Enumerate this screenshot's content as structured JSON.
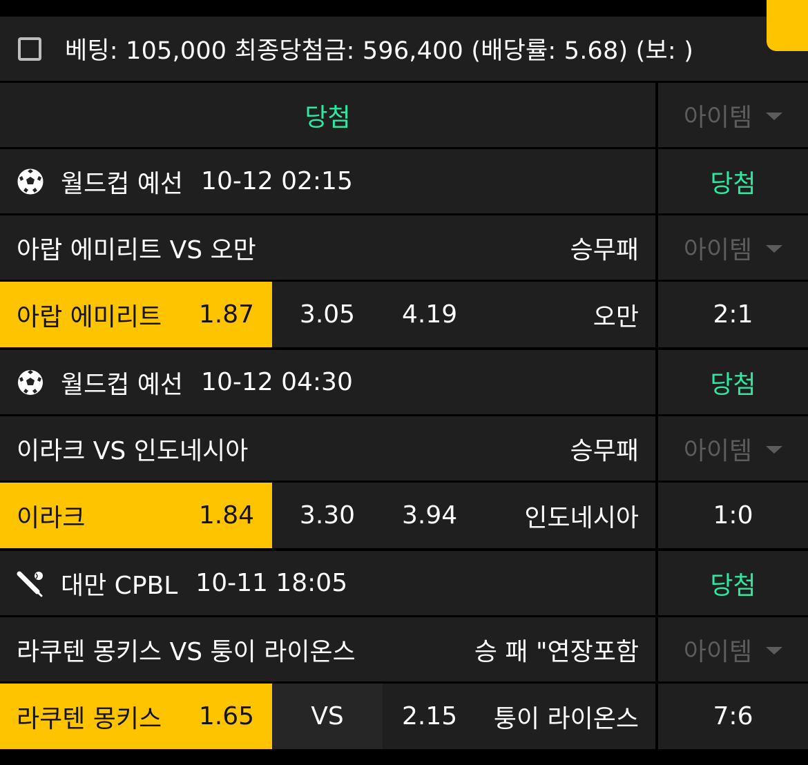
{
  "colors": {
    "accent_yellow": "#ffc400",
    "win_green": "#2ee8a0",
    "muted_gray": "#5c5c5c",
    "cell_bg": "#1f1f1f"
  },
  "header": {
    "summary": "베팅: 105,000 최종당첨금: 596,400 (배당률: 5.68) (보: )"
  },
  "status_row": {
    "result": "당첨",
    "item_label": "아이템"
  },
  "games": [
    {
      "sport_icon": "soccer-ball-icon",
      "league": "월드컵 예선",
      "datetime": "10-12 02:15",
      "result": "당첨",
      "match": "아랍 에미리트 VS 오만",
      "market": "승무패",
      "item_label": "아이템",
      "home": "아랍 에미리트",
      "home_odds": "1.87",
      "draw": "3.05",
      "away_odds": "4.19",
      "away": "오만",
      "score": "2:1"
    },
    {
      "sport_icon": "soccer-ball-icon",
      "league": "월드컵 예선",
      "datetime": "10-12 04:30",
      "result": "당첨",
      "match": "이라크 VS 인도네시아",
      "market": "승무패",
      "item_label": "아이템",
      "home": "이라크",
      "home_odds": "1.84",
      "draw": "3.30",
      "away_odds": "3.94",
      "away": "인도네시아",
      "score": "1:0"
    },
    {
      "sport_icon": "baseball-bat-icon",
      "league": "대만 CPBL",
      "datetime": "10-11 18:05",
      "result": "당첨",
      "match": "라쿠텐 몽키스 VS 퉁이 라이온스",
      "market": "승 패 \"연장포함",
      "item_label": "아이템",
      "home": "라쿠텐 몽키스",
      "home_odds": "1.65",
      "draw": "VS",
      "away_odds": "2.15",
      "away": "퉁이 라이온스",
      "score": "7:6"
    }
  ]
}
